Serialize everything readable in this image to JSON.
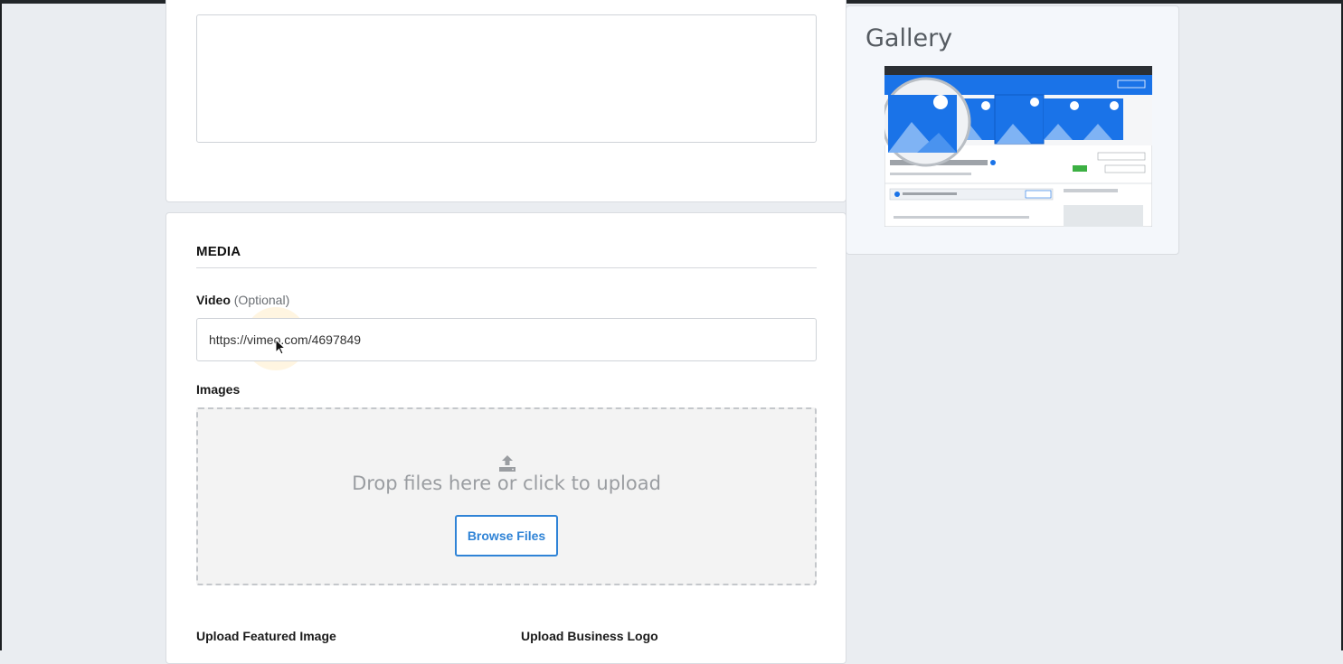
{
  "media": {
    "title": "MEDIA",
    "video_label": "Video",
    "video_optional": "(Optional)",
    "video_value": "https://vimeo.com/4697849",
    "images_label": "Images",
    "drop_text": "Drop files here or click to upload",
    "browse_label": "Browse Files",
    "featured_label": "Upload Featured Image",
    "logo_label": "Upload Business Logo"
  },
  "gallery": {
    "title": "Gallery"
  },
  "colors": {
    "accent": "#2f83d6",
    "page_bg": "#eaedf1"
  },
  "icons": [
    "upload-icon",
    "mouse-cursor-icon"
  ]
}
